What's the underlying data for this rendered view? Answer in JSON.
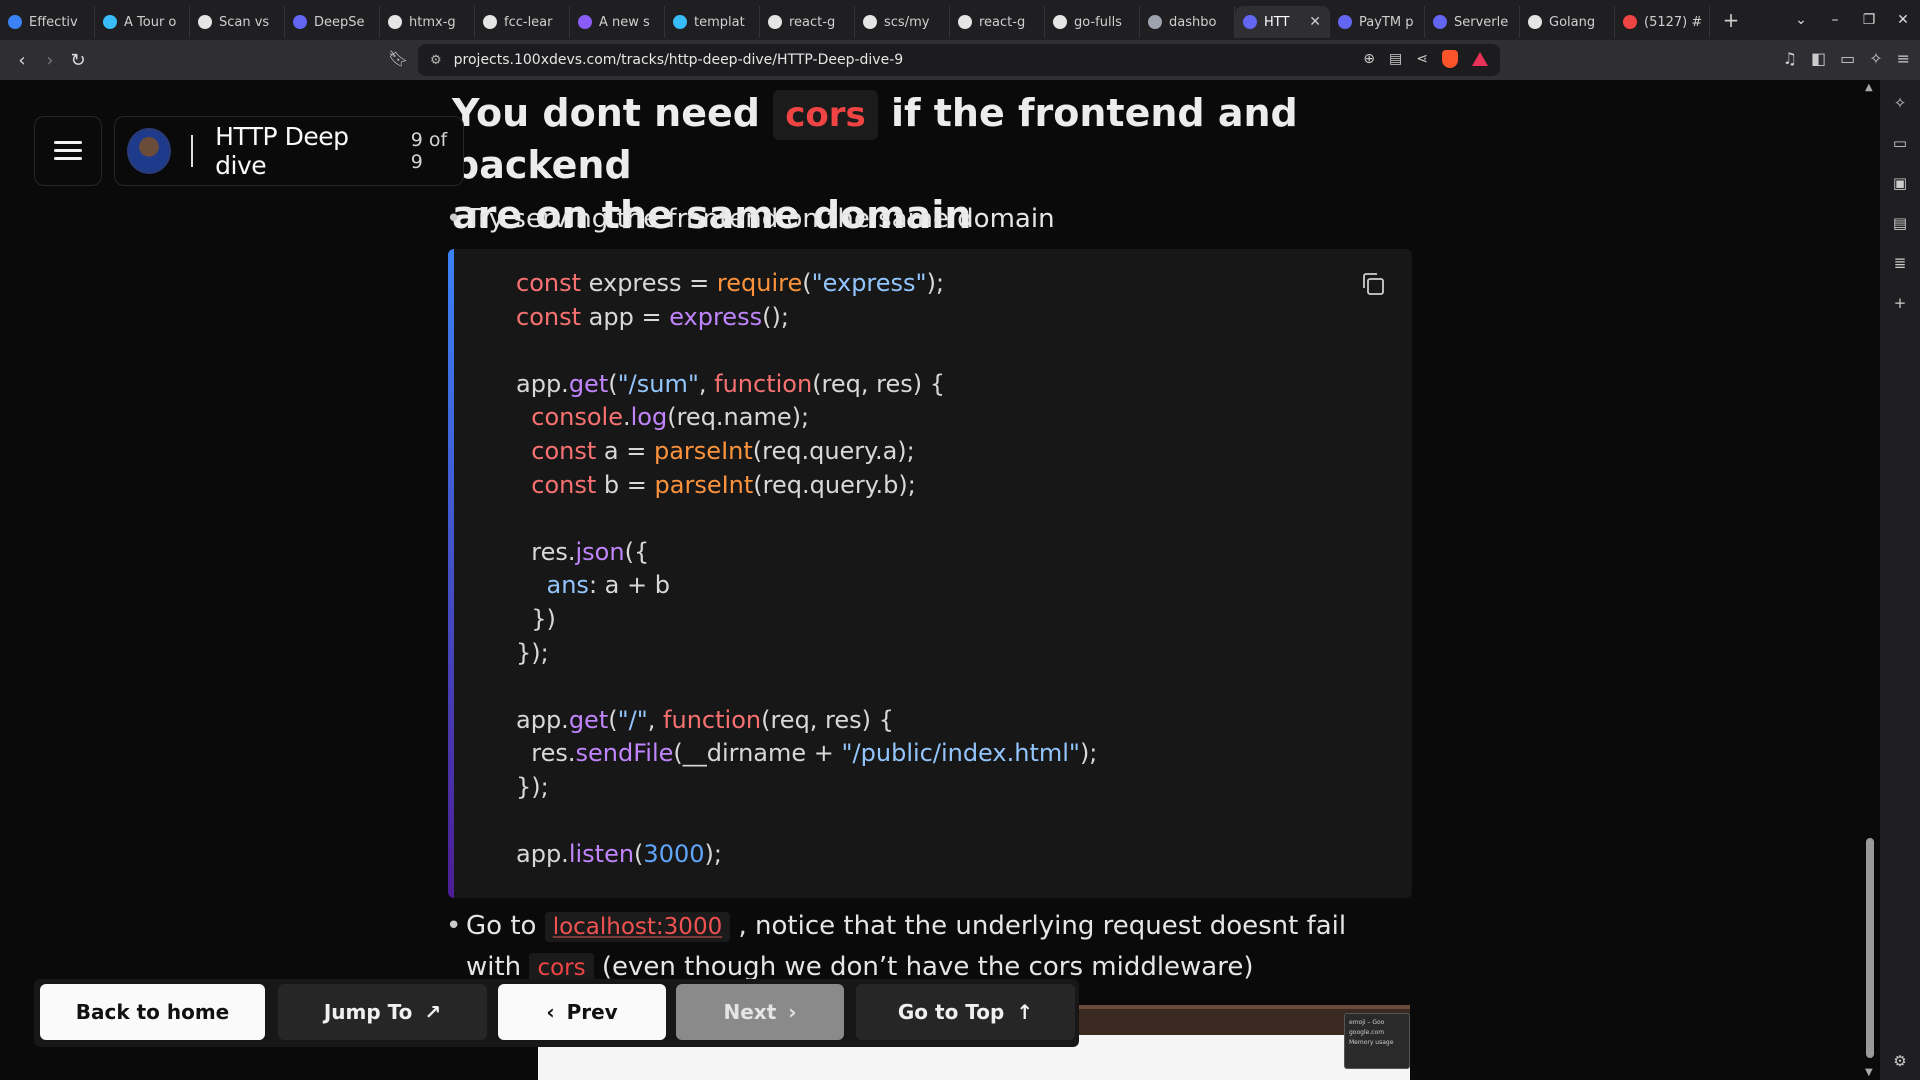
{
  "browser": {
    "tabs": [
      {
        "label": "Effectiv",
        "color": "#3b82f6"
      },
      {
        "label": "A Tour o",
        "color": "#38bdf8"
      },
      {
        "label": "Scan vs",
        "color": "#e5e5e5"
      },
      {
        "label": "DeepSe",
        "color": "#6366f1"
      },
      {
        "label": "htmx-g",
        "color": "#e5e5e5"
      },
      {
        "label": "fcc-lear",
        "color": "#e5e5e5"
      },
      {
        "label": "A new s",
        "color": "#8b5cf6"
      },
      {
        "label": "templat",
        "color": "#38bdf8"
      },
      {
        "label": "react-g",
        "color": "#e5e5e5"
      },
      {
        "label": "scs/my",
        "color": "#e5e5e5"
      },
      {
        "label": "react-g",
        "color": "#e5e5e5"
      },
      {
        "label": "go-fulls",
        "color": "#e5e5e5"
      },
      {
        "label": "dashbo",
        "color": "#9ca3af"
      },
      {
        "label": "HTT",
        "color": "#6366f1",
        "active": true
      },
      {
        "label": "PayTM p",
        "color": "#6366f1"
      },
      {
        "label": "Serverle",
        "color": "#6366f1"
      },
      {
        "label": "Golang",
        "color": "#e5e5e5"
      },
      {
        "label": "(5127) #",
        "color": "#ef4444"
      }
    ],
    "url": "projects.100xdevs.com/tracks/http-deep-dive/HTTP-Deep-dive-9"
  },
  "track": {
    "title": "HTTP Deep dive",
    "progress_text": "9 of 9"
  },
  "content": {
    "heading_part1": "You dont need",
    "heading_chip": "cors",
    "heading_part2": "if the frontend and backend",
    "heading_line2": "are on the same domain",
    "bullet1": "Try serving the frontend on the same domain",
    "bullet2_part1": "Go to",
    "bullet2_link": "localhost:3000",
    "bullet2_part2": ", notice that the underlying request doesnt fail with",
    "bullet2_chip": "cors",
    "bullet2_part3": "(even though we don’t have the cors middleware)"
  },
  "code_lines": [
    [
      [
        "kw",
        "const"
      ],
      [
        "p",
        " express = "
      ],
      [
        "fn",
        "require"
      ],
      [
        "p",
        "("
      ],
      [
        "str",
        "\"express\""
      ],
      [
        "p",
        ");"
      ]
    ],
    [
      [
        "kw",
        "const"
      ],
      [
        "p",
        " app = "
      ],
      [
        "fn2",
        "express"
      ],
      [
        "p",
        "();"
      ]
    ],
    [],
    [
      [
        "p",
        "app."
      ],
      [
        "fn2",
        "get"
      ],
      [
        "p",
        "("
      ],
      [
        "str",
        "\"/sum\""
      ],
      [
        "p",
        ", "
      ],
      [
        "kw",
        "function"
      ],
      [
        "p",
        "(req, res) {"
      ]
    ],
    [
      [
        "p",
        "  "
      ],
      [
        "kw",
        "console"
      ],
      [
        "p",
        "."
      ],
      [
        "fn2",
        "log"
      ],
      [
        "p",
        "(req.name);"
      ]
    ],
    [
      [
        "p",
        "  "
      ],
      [
        "kw",
        "const"
      ],
      [
        "p",
        " a = "
      ],
      [
        "fn",
        "parseInt"
      ],
      [
        "p",
        "(req.query.a);"
      ]
    ],
    [
      [
        "p",
        "  "
      ],
      [
        "kw",
        "const"
      ],
      [
        "p",
        " b = "
      ],
      [
        "fn",
        "parseInt"
      ],
      [
        "p",
        "(req.query.b);"
      ]
    ],
    [],
    [
      [
        "p",
        "  res."
      ],
      [
        "fn2",
        "json"
      ],
      [
        "p",
        "({"
      ]
    ],
    [
      [
        "p",
        "    "
      ],
      [
        "str",
        "ans"
      ],
      [
        "p",
        ": a + b"
      ]
    ],
    [
      [
        "p",
        "  })"
      ]
    ],
    [
      [
        "p",
        "});"
      ]
    ],
    [],
    [
      [
        "p",
        "app."
      ],
      [
        "fn2",
        "get"
      ],
      [
        "p",
        "("
      ],
      [
        "str",
        "\"/\""
      ],
      [
        "p",
        ", "
      ],
      [
        "kw",
        "function"
      ],
      [
        "p",
        "(req, res) {"
      ]
    ],
    [
      [
        "p",
        "  res."
      ],
      [
        "fn2",
        "sendFile"
      ],
      [
        "p",
        "(__dirname + "
      ],
      [
        "str",
        "\"/public/index.html\""
      ],
      [
        "p",
        ");"
      ]
    ],
    [
      [
        "p",
        "});"
      ]
    ],
    [],
    [
      [
        "p",
        "app."
      ],
      [
        "fn2",
        "listen"
      ],
      [
        "p",
        "("
      ],
      [
        "num",
        "3000"
      ],
      [
        "p",
        ");"
      ]
    ]
  ],
  "nav": {
    "back_home": "Back to home",
    "jump_to": "Jump To",
    "prev": "Prev",
    "next": "Next",
    "go_top": "Go to Top"
  },
  "preview": {
    "popup_line1": "emoji – Goo",
    "popup_line2": "google.com",
    "popup_line3": "Memory usage"
  }
}
